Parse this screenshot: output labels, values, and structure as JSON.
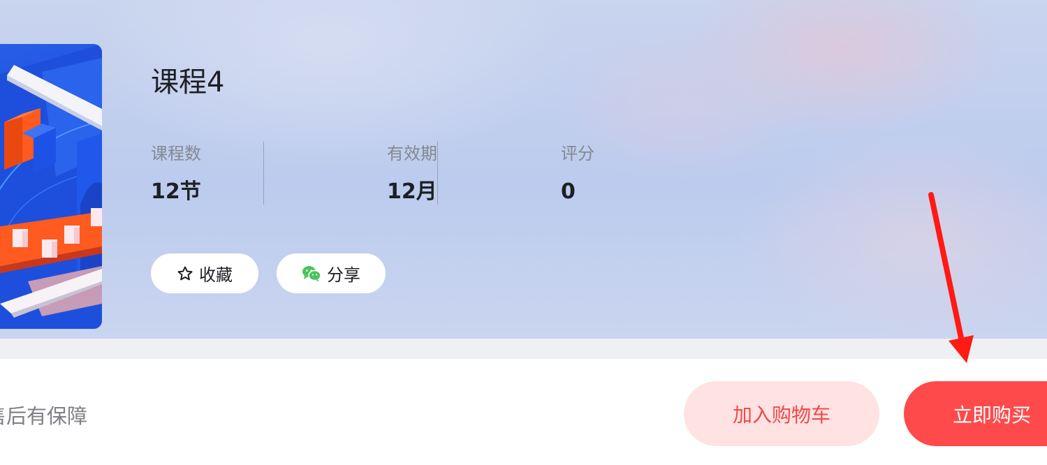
{
  "course": {
    "title": "课程4",
    "stats": [
      {
        "label": "课程数",
        "value": "12节"
      },
      {
        "label": "有效期",
        "value": "12月"
      },
      {
        "label": "评分",
        "value": "0"
      }
    ],
    "actions": {
      "favorite_label": "收藏",
      "share_label": "分享"
    }
  },
  "footer": {
    "guarantee_text": "售后有保障",
    "add_to_cart_label": "加入购物车",
    "buy_now_label": "立即购买"
  },
  "colors": {
    "buy_button": "#fe4a4b",
    "cart_button_bg": "#ffe2e2",
    "cart_button_text": "#f1494a",
    "annotation_arrow": "#ff1a14",
    "wechat_green": "#4cc35d"
  },
  "icons": {
    "favorite": "star-outline-icon",
    "share": "wechat-icon",
    "annotation": "arrow-down-icon"
  }
}
